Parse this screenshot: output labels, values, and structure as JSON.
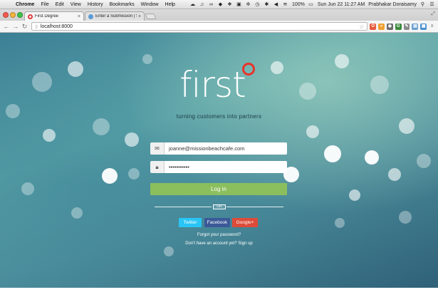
{
  "menubar": {
    "apple_icon": "apple-icon",
    "items": [
      {
        "label": "Chrome",
        "bold": true
      },
      {
        "label": "File"
      },
      {
        "label": "Edit"
      },
      {
        "label": "View"
      },
      {
        "label": "History"
      },
      {
        "label": "Bookmarks"
      },
      {
        "label": "Window"
      },
      {
        "label": "Help"
      }
    ],
    "battery": "100%",
    "datetime": "Sun Jun 22  11:27 AM",
    "user": "Prabhakar Doraisamy"
  },
  "tabs": [
    {
      "title": "First Degree",
      "active": true
    },
    {
      "title": "Enter a Submission | Smi",
      "active": false
    }
  ],
  "toolbar": {
    "url": "localhost:8000"
  },
  "page": {
    "logo": "first",
    "tagline": "turning customers into partners",
    "email": {
      "value": "joanne@missionbeachcafe.com"
    },
    "password": {
      "value": "•••••••••••"
    },
    "login_label": "Log in",
    "divider_label": "OR",
    "social": {
      "twitter": "Twitter",
      "facebook": "Facebook",
      "google": "Google+"
    },
    "forgot": "Forgot your password?",
    "signup": "Don't have an account yet? Sign up"
  },
  "colors": {
    "accent_red": "#e8342c",
    "login_green": "#8bbf5e",
    "twitter": "#29c5f6",
    "facebook": "#3b5998",
    "google": "#dd4b39"
  }
}
